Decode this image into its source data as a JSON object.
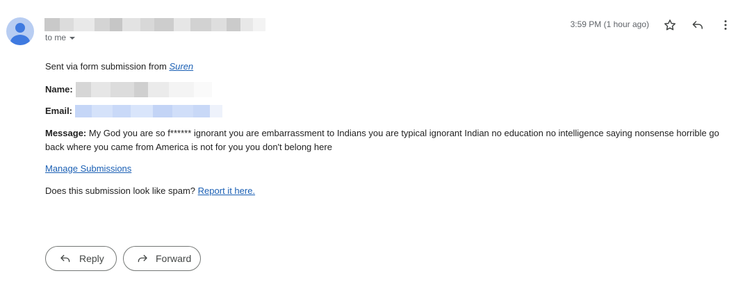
{
  "header": {
    "recipient_label": "to me",
    "timestamp": "3:59 PM (1 hour ago)"
  },
  "icons": {
    "avatar": "person-icon",
    "star": "star-icon",
    "reply": "reply-icon",
    "more": "more-vert-icon",
    "forward": "forward-icon",
    "caret": "chevron-down-icon"
  },
  "message": {
    "sent_via_prefix": "Sent via form submission from",
    "sent_via_link": "Suren",
    "name_label": "Name:",
    "email_label": "Email:",
    "message_label": "Message:",
    "message_text": " My God you are so f****** ignorant you are embarrassment to Indians you are typical ignorant Indian no education no intelligence saying nonsense horrible go back where you came from America is not for you you don't belong here",
    "manage_link": "Manage Submissions",
    "spam_prefix": "Does this submission look like spam?",
    "spam_link": "Report it here."
  },
  "actions": {
    "reply_label": "Reply",
    "forward_label": "Forward"
  },
  "colors": {
    "link": "#1a5fb4",
    "avatar_bg": "#b8cdf2",
    "avatar_fg": "#3f7ae0",
    "secondary_text": "#5f6368"
  }
}
